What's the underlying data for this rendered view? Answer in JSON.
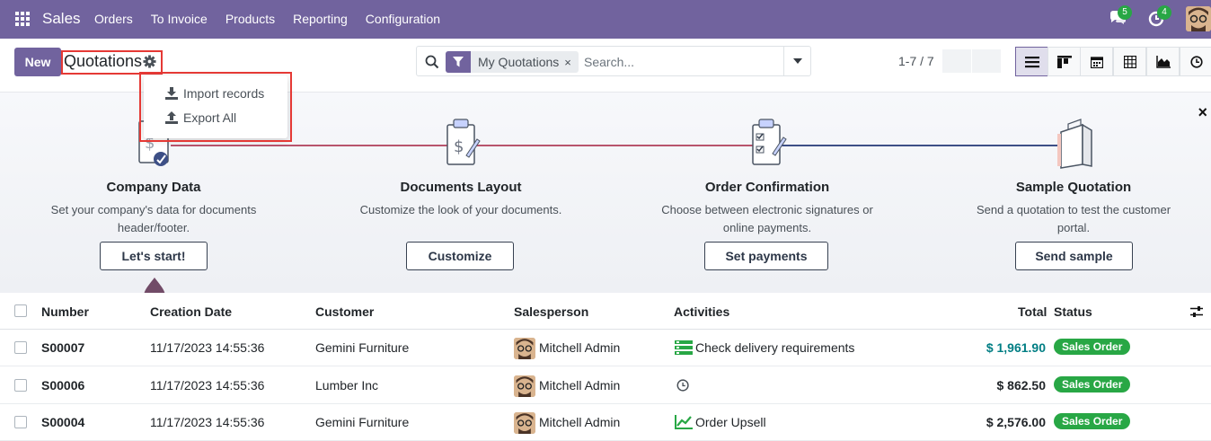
{
  "navbar": {
    "brand": "Sales",
    "menu": [
      "Orders",
      "To Invoice",
      "Products",
      "Reporting",
      "Configuration"
    ],
    "messages_count": "5",
    "activities_count": "4",
    "colors": {
      "bar": "#71639e",
      "badge": "#28a745"
    }
  },
  "control_panel": {
    "new_label": "New",
    "title": "Quotations",
    "actions_menu": [
      "Import records",
      "Export All"
    ],
    "search": {
      "facet": "My Quotations",
      "facet_remove": "×",
      "placeholder": "Search..."
    },
    "pager": "1-7 / 7",
    "views": [
      "list-view-icon",
      "kanban-view-icon",
      "calendar-view-icon",
      "pivot-view-icon",
      "graph-view-icon",
      "activity-view-icon"
    ]
  },
  "onboarding": {
    "close": "×",
    "steps": [
      {
        "title": "Company Data",
        "description": "Set your company's data for documents header/footer.",
        "button": "Let's start!"
      },
      {
        "title": "Documents Layout",
        "description": "Customize the look of your documents.",
        "button": "Customize"
      },
      {
        "title": "Order Confirmation",
        "description": "Choose between electronic signatures or online payments.",
        "button": "Set payments"
      },
      {
        "title": "Sample Quotation",
        "description": "Send a quotation to test the customer portal.",
        "button": "Send sample"
      }
    ]
  },
  "list": {
    "columns": [
      "Number",
      "Creation Date",
      "Customer",
      "Salesperson",
      "Activities",
      "Total",
      "Status"
    ],
    "rows": [
      {
        "number": "S00007",
        "date": "11/17/2023 14:55:36",
        "customer": "Gemini Furniture",
        "salesperson": "Mitchell Admin",
        "activity_icon": "todo-list-icon",
        "activity": "Check delivery requirements",
        "total": "$ 1,961.90",
        "status": "Sales Order"
      },
      {
        "number": "S00006",
        "date": "11/17/2023 14:55:36",
        "customer": "Lumber Inc",
        "salesperson": "Mitchell Admin",
        "activity_icon": "clock-icon",
        "activity": "",
        "total": "$ 862.50",
        "status": "Sales Order"
      },
      {
        "number": "S00004",
        "date": "11/17/2023 14:55:36",
        "customer": "Gemini Furniture",
        "salesperson": "Mitchell Admin",
        "activity_icon": "upsell-chart-icon",
        "activity": "Order Upsell",
        "total": "$ 2,576.00",
        "status": "Sales Order"
      }
    ]
  }
}
